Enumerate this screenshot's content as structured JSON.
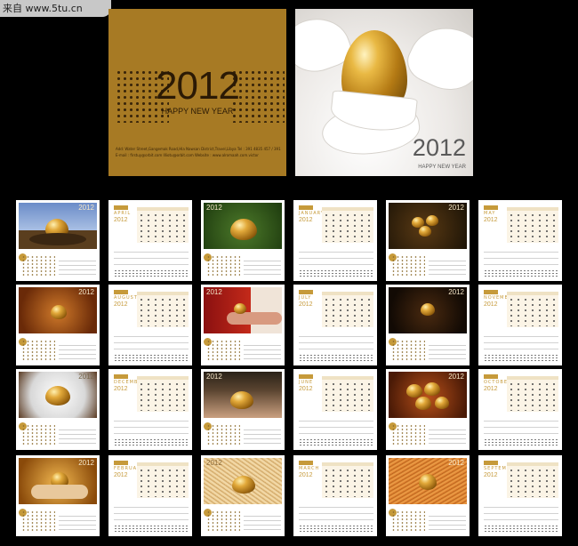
{
  "watermark": {
    "text": "来自 www.5tu.cn"
  },
  "front_cover": {
    "year": "2012",
    "greeting": "HAPPY NEW YEAR",
    "address_line": "Add:  Water Street,Gangemak Road,Hla Nawsan District,Travel,Libya          Tel : 391 4835 457  /  391 7750 164",
    "contact_line": "E-mail : firstuy@orbit.com          Illiotu@orbit.com                    Website : www.alromaah.com.victor"
  },
  "back_cover": {
    "year": "2012",
    "greeting": "HAPPY NEW YEAR"
  },
  "month_pages": [
    {
      "month": "APRIL",
      "year": "2012"
    },
    {
      "month": "JANUARY",
      "year": "2012"
    },
    {
      "month": "MAY",
      "year": "2012"
    },
    {
      "month": "AUGUST",
      "year": "2012"
    },
    {
      "month": "JULY",
      "year": "2012"
    },
    {
      "month": "NOVEMBER",
      "year": "2012"
    },
    {
      "month": "DECEMBER",
      "year": "2012"
    },
    {
      "month": "JUNE",
      "year": "2012"
    },
    {
      "month": "OCTOBER",
      "year": "2012"
    },
    {
      "month": "FEBRUARY",
      "year": "2012"
    },
    {
      "month": "MARCH",
      "year": "2012"
    },
    {
      "month": "SEPTEMBER",
      "year": "2012"
    }
  ],
  "photo_pages": [
    {
      "year": "2012",
      "subject": "golden egg in nest, blue sky"
    },
    {
      "year": "2012",
      "subject": "golden egg in grass"
    },
    {
      "year": "2012",
      "subject": "three glowing eggs in nest"
    },
    {
      "year": "2012",
      "subject": "glowing golden egg, warm haze"
    },
    {
      "year": "2012",
      "subject": "golden egg in palm, red background"
    },
    {
      "year": "2012",
      "subject": "glowing eggs in dark nest"
    },
    {
      "year": "2012",
      "subject": "hands around pile of golden eggs"
    },
    {
      "year": "2012",
      "subject": "hands holding golden eggs"
    },
    {
      "year": "2012",
      "subject": "golden eggs in clay pot"
    },
    {
      "year": "2012",
      "subject": "golden egg held in hands"
    },
    {
      "year": "2012",
      "subject": "golden egg in straw"
    },
    {
      "year": "2012",
      "subject": "golden egg in straw, orange"
    }
  ],
  "colors": {
    "gold_cover": "#a77a24",
    "accent": "#c69a3a",
    "background": "#000000"
  }
}
